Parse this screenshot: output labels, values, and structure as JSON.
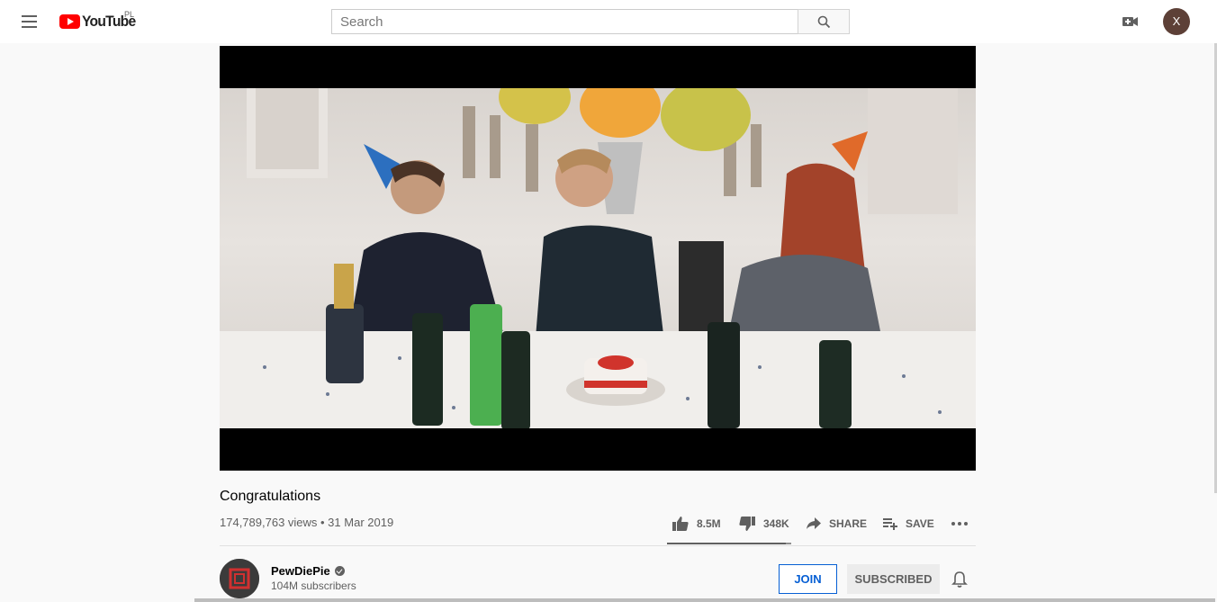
{
  "header": {
    "logo_text": "YouTube",
    "logo_region": "PL",
    "search_placeholder": "Search",
    "avatar_initial": "X"
  },
  "video": {
    "title": "Congratulations",
    "views_date": "174,789,763 views • 31 Mar 2019",
    "like_ratio": 0.96
  },
  "actions": {
    "likes": "8.5M",
    "dislikes": "348K",
    "share": "SHARE",
    "save": "SAVE"
  },
  "channel": {
    "name": "PewDiePie",
    "subscribers": "104M subscribers",
    "join_label": "JOIN",
    "subscribed_label": "SUBSCRIBED"
  },
  "colors": {
    "brand_red": "#ff0000",
    "join_blue": "#065fd4",
    "avatar_bg": "#5d4037"
  }
}
